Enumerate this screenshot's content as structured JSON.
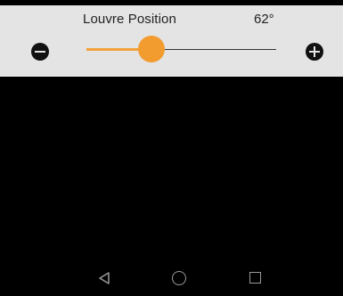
{
  "control": {
    "label": "Louvre Position",
    "value_text": "62°",
    "value": 62
  },
  "icons": {
    "decrease": "minus-circle-icon",
    "increase": "plus-circle-icon",
    "back": "back-triangle-icon",
    "home": "home-circle-icon",
    "recents": "recents-square-icon"
  },
  "colors": {
    "panel_background": "#e4e4e4",
    "accent": "#f29c30",
    "screen_background": "#000000"
  }
}
